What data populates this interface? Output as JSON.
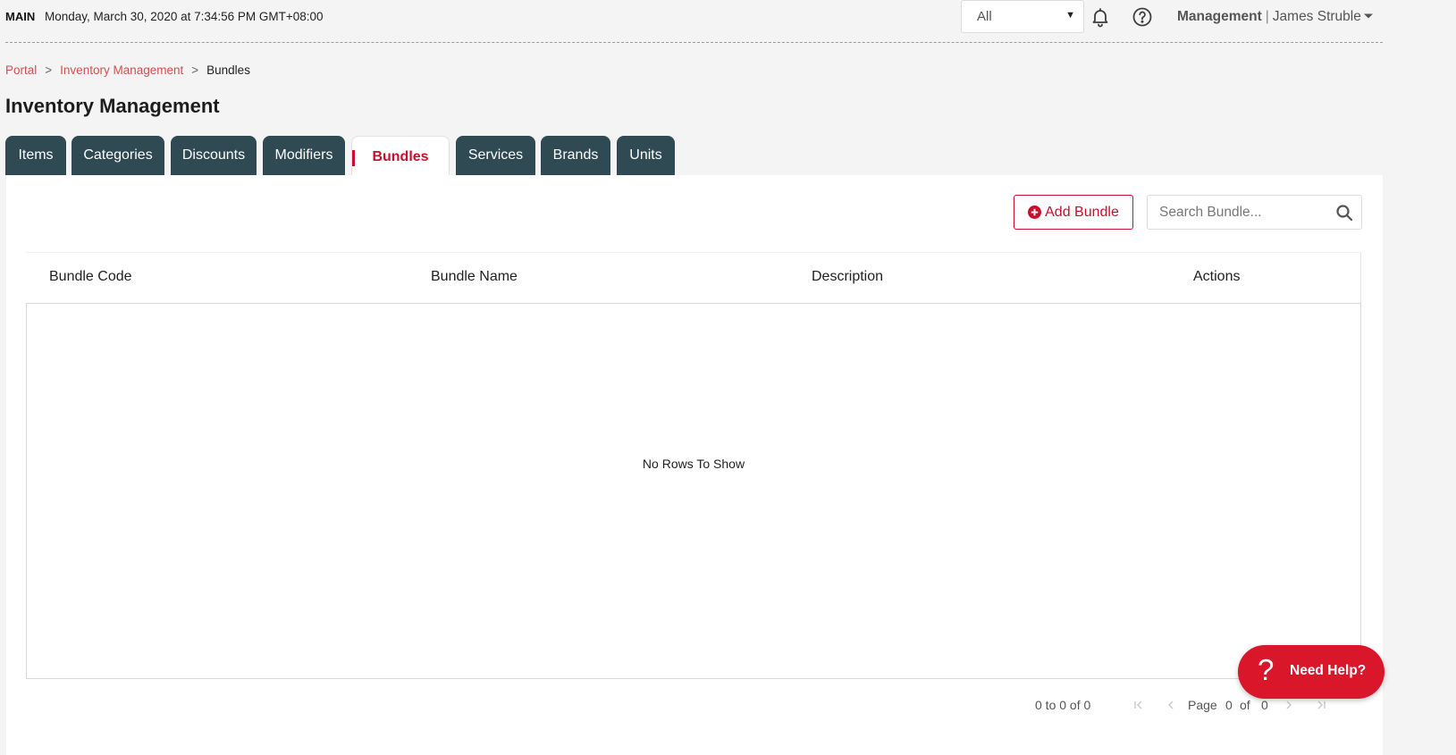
{
  "topbar": {
    "brand": "MAIN",
    "datetime": "Monday, March 30, 2020 at 7:34:56 PM GMT+08:00",
    "store_select": "All",
    "user_role": "Management",
    "user_separator": "|",
    "user_name": "James Struble"
  },
  "breadcrumb": {
    "items": [
      "Portal",
      "Inventory Management"
    ],
    "separator": ">",
    "current": "Bundles"
  },
  "page_title": "Inventory Management",
  "tabs": [
    {
      "label": "Items"
    },
    {
      "label": "Categories"
    },
    {
      "label": "Discounts"
    },
    {
      "label": "Modifiers"
    },
    {
      "label": "Bundles",
      "active": true
    },
    {
      "label": "Services"
    },
    {
      "label": "Brands"
    },
    {
      "label": "Units"
    }
  ],
  "toolbar": {
    "add_label": "Add Bundle",
    "search_placeholder": "Search Bundle..."
  },
  "grid": {
    "columns": [
      "Bundle Code",
      "Bundle Name",
      "Description",
      "Actions"
    ],
    "empty_message": "No Rows To Show"
  },
  "pager": {
    "summary": "0 to 0 of 0",
    "page_label": "Page",
    "current_page": "0",
    "of_label": "of",
    "total_pages": "0"
  },
  "help_widget": {
    "icon_glyph": "?",
    "label": "Need Help?"
  },
  "colors": {
    "accent": "#c8102e",
    "tab_bg": "#2f4a53",
    "link": "#d25050",
    "page_bg": "#f3f4f3"
  }
}
